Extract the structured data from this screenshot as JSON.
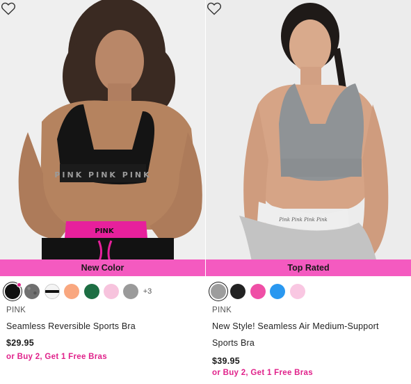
{
  "products": [
    {
      "badge": "New Color",
      "brand": "PINK",
      "name": "Seamless Reversible Sports Bra",
      "price": "$29.95",
      "promo": "or Buy 2, Get 1 Free Bras",
      "more_colors": "+3",
      "swatches": [
        "#111111",
        "#6f6f6f",
        "#f4f4f4",
        "#f9a77f",
        "#1d6e43",
        "#f7c3dd",
        "#9a9a9a"
      ]
    },
    {
      "badge": "Top Rated",
      "brand": "PINK",
      "name": "New Style! Seamless Air Medium-Support Sports Bra",
      "price": "$39.95",
      "promo": "or Buy 2, Get 1 Free Bras",
      "swatches": [
        "#9d9d9d",
        "#222222",
        "#ef4fa6",
        "#2a98f0",
        "#f9c7e2"
      ]
    }
  ],
  "colors": {
    "badge_bg": "#f45ac0",
    "promo_text": "#e0218a",
    "photo_bg": "#ededed"
  },
  "icons": {
    "favorite": "heart-outline-icon"
  }
}
